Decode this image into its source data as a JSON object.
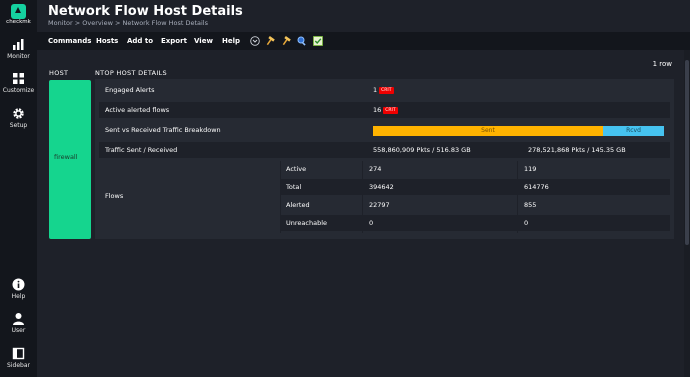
{
  "sidebar": {
    "brand": "checkmk",
    "items": [
      {
        "label": "Monitor",
        "icon": "bar-chart-icon"
      },
      {
        "label": "Customize",
        "icon": "grid-icon"
      },
      {
        "label": "Setup",
        "icon": "gear-icon"
      }
    ],
    "bottom_items": [
      {
        "label": "Help",
        "icon": "info-icon"
      },
      {
        "label": "User",
        "icon": "user-icon"
      },
      {
        "label": "Sidebar",
        "icon": "sidebar-icon"
      }
    ]
  },
  "header": {
    "title": "Network Flow Host Details",
    "breadcrumb": "Monitor > Overview > Network Flow Host Details"
  },
  "menu": {
    "items": [
      "Commands",
      "Hosts",
      "Add to",
      "Export",
      "View",
      "Help"
    ]
  },
  "table": {
    "row_count": "1 row",
    "col_host": "HOST",
    "col_details": "NTOP HOST DETAILS",
    "host": "firewall",
    "engaged_alerts": {
      "label": "Engaged Alerts",
      "value": "1",
      "badge": "CRIT"
    },
    "active_alerted_flows": {
      "label": "Active alerted flows",
      "value": "16",
      "badge": "CRIT"
    },
    "traffic_breakdown": {
      "label": "Sent vs Received Traffic Breakdown",
      "sent_label": "Sent",
      "rcvd_label": "Rcvd",
      "sent_fraction": 0.79
    },
    "traffic_sent_received": {
      "label": "Traffic Sent / Received",
      "sent": "558,860,909 Pkts / 516.83 GB",
      "received": "278,521,868 Pkts / 145.35 GB"
    },
    "flows": {
      "label": "Flows",
      "rows": [
        {
          "name": "Active",
          "a": "274",
          "b": "119"
        },
        {
          "name": "Total",
          "a": "394642",
          "b": "614776"
        },
        {
          "name": "Alerted",
          "a": "22797",
          "b": "855"
        },
        {
          "name": "Unreachable",
          "a": "0",
          "b": "0"
        }
      ]
    }
  },
  "colors": {
    "host_ok": "#15d58e",
    "crit": "#ee0000",
    "sent": "#ffb300",
    "rcvd": "#46c3f0",
    "brand": "#15d1a0"
  }
}
